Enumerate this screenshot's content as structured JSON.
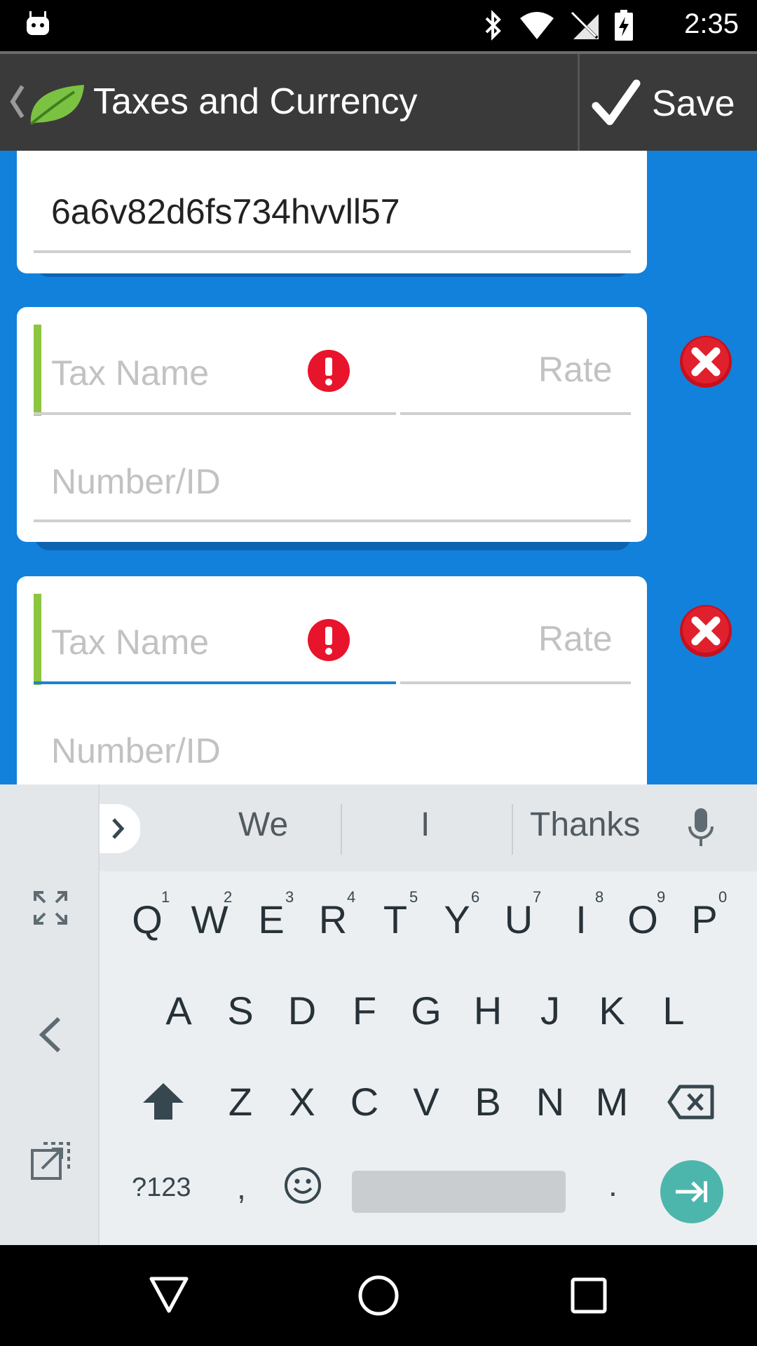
{
  "status_bar": {
    "time": "2:35"
  },
  "action_bar": {
    "title": "Taxes and Currency",
    "save_label": "Save"
  },
  "tax_entries": [
    {
      "value": "6a6v82d6fs734hvvll57"
    },
    {
      "name_placeholder": "Tax Name",
      "rate_placeholder": "Rate",
      "number_placeholder": "Number/ID"
    },
    {
      "name_placeholder": "Tax Name",
      "rate_placeholder": "Rate",
      "number_placeholder": "Number/ID"
    }
  ],
  "keyboard": {
    "suggestions": [
      "We",
      "I",
      "Thanks"
    ],
    "row1": [
      "Q",
      "W",
      "E",
      "R",
      "T",
      "Y",
      "U",
      "I",
      "O",
      "P"
    ],
    "row1_hints": [
      "1",
      "2",
      "3",
      "4",
      "5",
      "6",
      "7",
      "8",
      "9",
      "0"
    ],
    "row2": [
      "A",
      "S",
      "D",
      "F",
      "G",
      "H",
      "J",
      "K",
      "L"
    ],
    "row3": [
      "Z",
      "X",
      "C",
      "V",
      "B",
      "N",
      "M"
    ],
    "symbols_label": "?123",
    "comma": ",",
    "period": "."
  }
}
